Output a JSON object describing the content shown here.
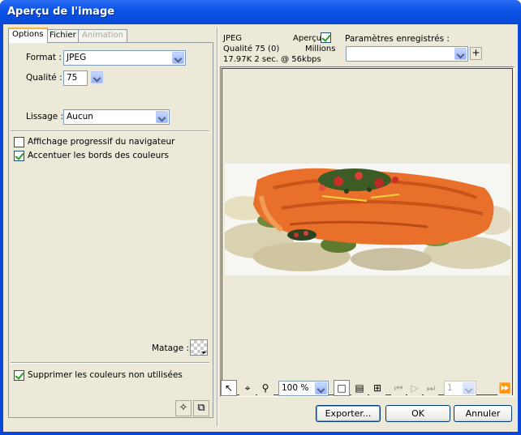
{
  "window": {
    "title": "Aperçu de l'image"
  },
  "tabs": [
    {
      "label": "Options",
      "state": "active"
    },
    {
      "label": "Fichier",
      "state": "normal"
    },
    {
      "label": "Animation",
      "state": "disabled"
    }
  ],
  "options": {
    "format_label": "Format :",
    "format_value": "JPEG",
    "quality_label": "Qualité :",
    "quality_value": "75",
    "smoothing_label": "Lissage :",
    "smoothing_value": "Aucun",
    "progressive_label": "Affichage progressif du navigateur",
    "progressive_checked": false,
    "sharpen_label": "Accentuer les bords des couleurs",
    "sharpen_checked": true,
    "matte_label": "Matage :",
    "remove_unused_label": "Supprimer les couleurs non utilisées",
    "remove_unused_checked": true
  },
  "preview_info": {
    "format": "JPEG",
    "quality": "Qualité 75 (0)",
    "size": "17.97K  2 sec. @ 56kbps",
    "preview_label": "Aperçu",
    "preview_checked": true,
    "colors": "Millions"
  },
  "saved_settings": {
    "label": "Paramètres enregistrés :",
    "value": "",
    "add_symbol": "+"
  },
  "toolbar": {
    "zoom_value": "100 %",
    "frame_value": "1"
  },
  "buttons": {
    "export": "Exporter...",
    "ok": "OK",
    "cancel": "Annuler"
  },
  "colors": {
    "titlebar": "#0b54e6",
    "dialog_bg": "#ece9d8",
    "check_green": "#21a121",
    "salmon": "#e8702a"
  }
}
